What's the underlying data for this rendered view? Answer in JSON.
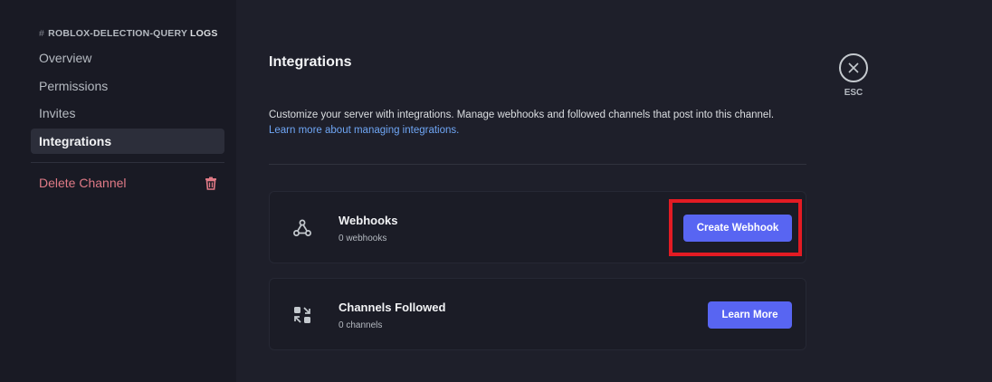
{
  "sidebar": {
    "header_prefix": "#",
    "header_channel": "ROBLOX-DELECTION-QUERY",
    "header_suffix": "LOGS",
    "items": [
      {
        "label": "Overview"
      },
      {
        "label": "Permissions"
      },
      {
        "label": "Invites"
      },
      {
        "label": "Integrations"
      }
    ],
    "delete_label": "Delete Channel"
  },
  "main": {
    "title": "Integrations",
    "description": "Customize your server with integrations. Manage webhooks and followed channels that post into this channel.",
    "learn_more_link": "Learn more about managing integrations.",
    "cards": [
      {
        "title": "Webhooks",
        "subtitle": "0 webhooks",
        "button": "Create Webhook",
        "icon": "webhook-icon"
      },
      {
        "title": "Channels Followed",
        "subtitle": "0 channels",
        "button": "Learn More",
        "icon": "channels-followed-icon"
      }
    ]
  },
  "close": {
    "label": "ESC"
  },
  "colors": {
    "accent": "#5865f2",
    "highlight": "#e31b23",
    "danger": "#e07a86",
    "link": "#6fa6f5"
  }
}
